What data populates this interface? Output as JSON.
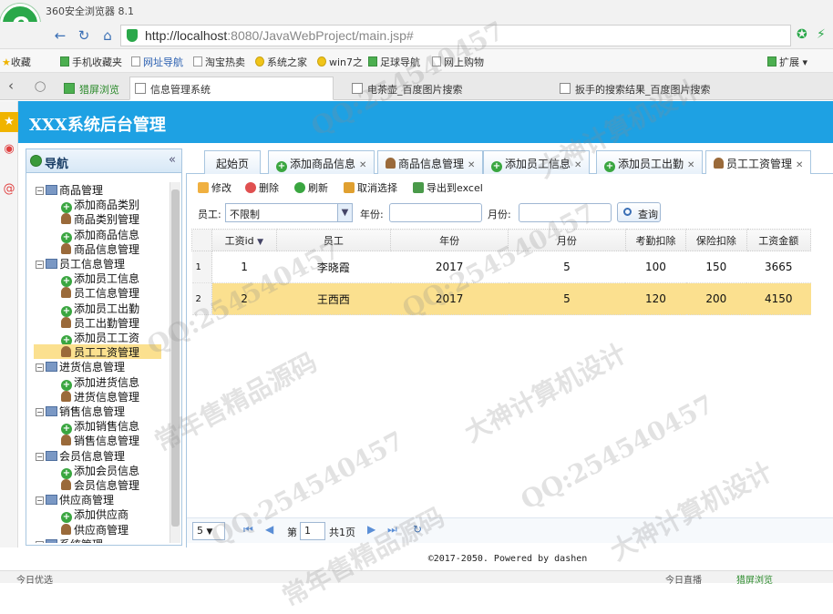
{
  "browser": {
    "title": "360安全浏览器 8.1",
    "url_host": "http://localhost",
    "url_rest": ":8080/JavaWebProject/main.jsp#",
    "favorites": [
      "收藏",
      "手机收藏夹",
      "网址导航",
      "淘宝热卖",
      "系统之家",
      "win7之",
      "足球导航",
      "网上购物"
    ],
    "ext_label": "扩展",
    "tabs": [
      {
        "label": "猎屏浏览",
        "active": false
      },
      {
        "label": "信息管理系统",
        "active": true
      },
      {
        "label": "电茶壶_百度图片搜索",
        "active": false
      },
      {
        "label": "扳手的搜索结果_百度图片搜索",
        "active": false
      }
    ]
  },
  "app": {
    "title": "XXX系统后台管理",
    "nav_title": "导航",
    "nav_tree": [
      {
        "label": "商品管理",
        "type": "group"
      },
      {
        "label": "添加商品类别",
        "type": "add"
      },
      {
        "label": "商品类别管理",
        "type": "user"
      },
      {
        "label": "添加商品信息",
        "type": "add"
      },
      {
        "label": "商品信息管理",
        "type": "user"
      },
      {
        "label": "员工信息管理",
        "type": "group"
      },
      {
        "label": "添加员工信息",
        "type": "add"
      },
      {
        "label": "员工信息管理",
        "type": "user"
      },
      {
        "label": "添加员工出勤",
        "type": "add"
      },
      {
        "label": "员工出勤管理",
        "type": "user"
      },
      {
        "label": "添加员工工资",
        "type": "add"
      },
      {
        "label": "员工工资管理",
        "type": "user",
        "selected": true
      },
      {
        "label": "进货信息管理",
        "type": "group"
      },
      {
        "label": "添加进货信息",
        "type": "add"
      },
      {
        "label": "进货信息管理",
        "type": "user"
      },
      {
        "label": "销售信息管理",
        "type": "group"
      },
      {
        "label": "添加销售信息",
        "type": "add"
      },
      {
        "label": "销售信息管理",
        "type": "user"
      },
      {
        "label": "会员信息管理",
        "type": "group"
      },
      {
        "label": "添加会员信息",
        "type": "add"
      },
      {
        "label": "会员信息管理",
        "type": "user"
      },
      {
        "label": "供应商管理",
        "type": "group"
      },
      {
        "label": "添加供应商",
        "type": "add"
      },
      {
        "label": "供应商管理",
        "type": "user"
      },
      {
        "label": "系统管理",
        "type": "group"
      }
    ],
    "page_tabs": [
      {
        "label": "起始页",
        "icon": "none",
        "closable": false
      },
      {
        "label": "添加商品信息",
        "icon": "add",
        "closable": true
      },
      {
        "label": "商品信息管理",
        "icon": "user",
        "closable": true
      },
      {
        "label": "添加员工信息",
        "icon": "add",
        "closable": true
      },
      {
        "label": "添加员工出勤",
        "icon": "add",
        "closable": true
      },
      {
        "label": "员工工资管理",
        "icon": "user",
        "closable": true,
        "active": true
      }
    ],
    "toolbar": {
      "edit": "修改",
      "delete": "删除",
      "refresh": "刷新",
      "unselect": "取消选择",
      "export": "导出到excel"
    },
    "filter": {
      "employee_label": "员工:",
      "employee_value": "不限制",
      "year_label": "年份:",
      "month_label": "月份:",
      "query": "查询"
    },
    "table": {
      "columns": [
        "工资id",
        "员工",
        "年份",
        "月份",
        "考勤扣除",
        "保险扣除",
        "工资金额"
      ],
      "rows": [
        {
          "rn": "1",
          "cells": [
            "1",
            "李晓霞",
            "2017",
            "5",
            "100",
            "150",
            "3665"
          ]
        },
        {
          "rn": "2",
          "cells": [
            "2",
            "王西西",
            "2017",
            "5",
            "120",
            "200",
            "4150"
          ],
          "selected": true
        }
      ]
    },
    "pager": {
      "page_size": "5",
      "page_label": "第",
      "page_value": "1",
      "total": "共1页"
    },
    "footer": "©2017-2050. Powered by dashen"
  },
  "statusbar": {
    "left": "今日优选",
    "right1": "今日直播",
    "right2": "猎屏浏览"
  },
  "watermarks": [
    "QQ:254540457",
    "大神计算机设计",
    "常年售精品源码"
  ]
}
